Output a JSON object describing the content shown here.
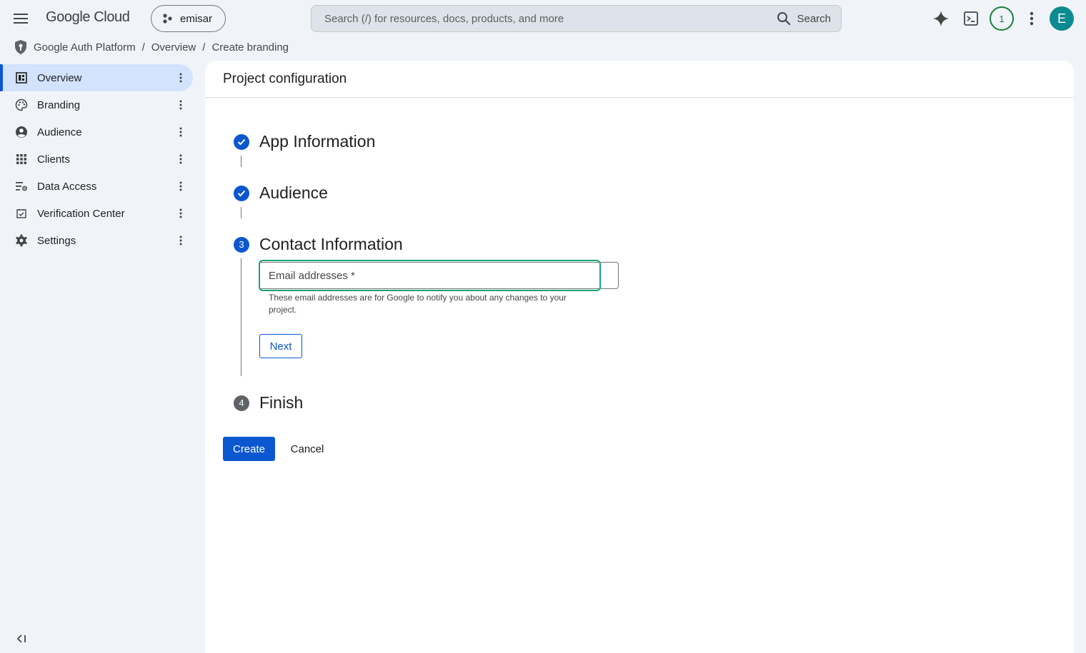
{
  "app": {
    "logo_text": "Google Cloud",
    "project_name": "emisar"
  },
  "search": {
    "placeholder": "Search (/) for resources, docs, products, and more",
    "button_label": "Search"
  },
  "topbar": {
    "notification_count": "1",
    "avatar_letter": "E",
    "icons": [
      "gemini-sparkle-icon",
      "cloud-shell-terminal-icon",
      "more-vert-icon"
    ]
  },
  "breadcrumb": {
    "items": [
      "Google Auth Platform",
      "Overview",
      "Create branding"
    ],
    "separator": "/"
  },
  "sidebar": {
    "items": [
      {
        "label": "Overview",
        "icon": "dashboard-icon",
        "active": true
      },
      {
        "label": "Branding",
        "icon": "palette-icon",
        "active": false
      },
      {
        "label": "Audience",
        "icon": "account-circle-icon",
        "active": false
      },
      {
        "label": "Clients",
        "icon": "apps-grid-icon",
        "active": false
      },
      {
        "label": "Data Access",
        "icon": "data-access-icon",
        "active": false
      },
      {
        "label": "Verification Center",
        "icon": "verification-icon",
        "active": false
      },
      {
        "label": "Settings",
        "icon": "gear-icon",
        "active": false
      }
    ]
  },
  "main": {
    "title": "Project configuration",
    "steps": [
      {
        "number": "1",
        "title": "App Information",
        "status": "done"
      },
      {
        "number": "2",
        "title": "Audience",
        "status": "done"
      },
      {
        "number": "3",
        "title": "Contact Information",
        "status": "current"
      },
      {
        "number": "4",
        "title": "Finish",
        "status": "todo"
      }
    ],
    "email_field": {
      "placeholder": "Email addresses *",
      "value": "",
      "helper": "These email addresses are for Google to notify you about any changes to your project."
    },
    "next_label": "Next",
    "create_label": "Create",
    "cancel_label": "Cancel"
  },
  "colors": {
    "accent": "#0b57d0",
    "focus_ring": "#1aa37a",
    "avatar_bg": "#0b8a8f",
    "badge": "#188038"
  }
}
